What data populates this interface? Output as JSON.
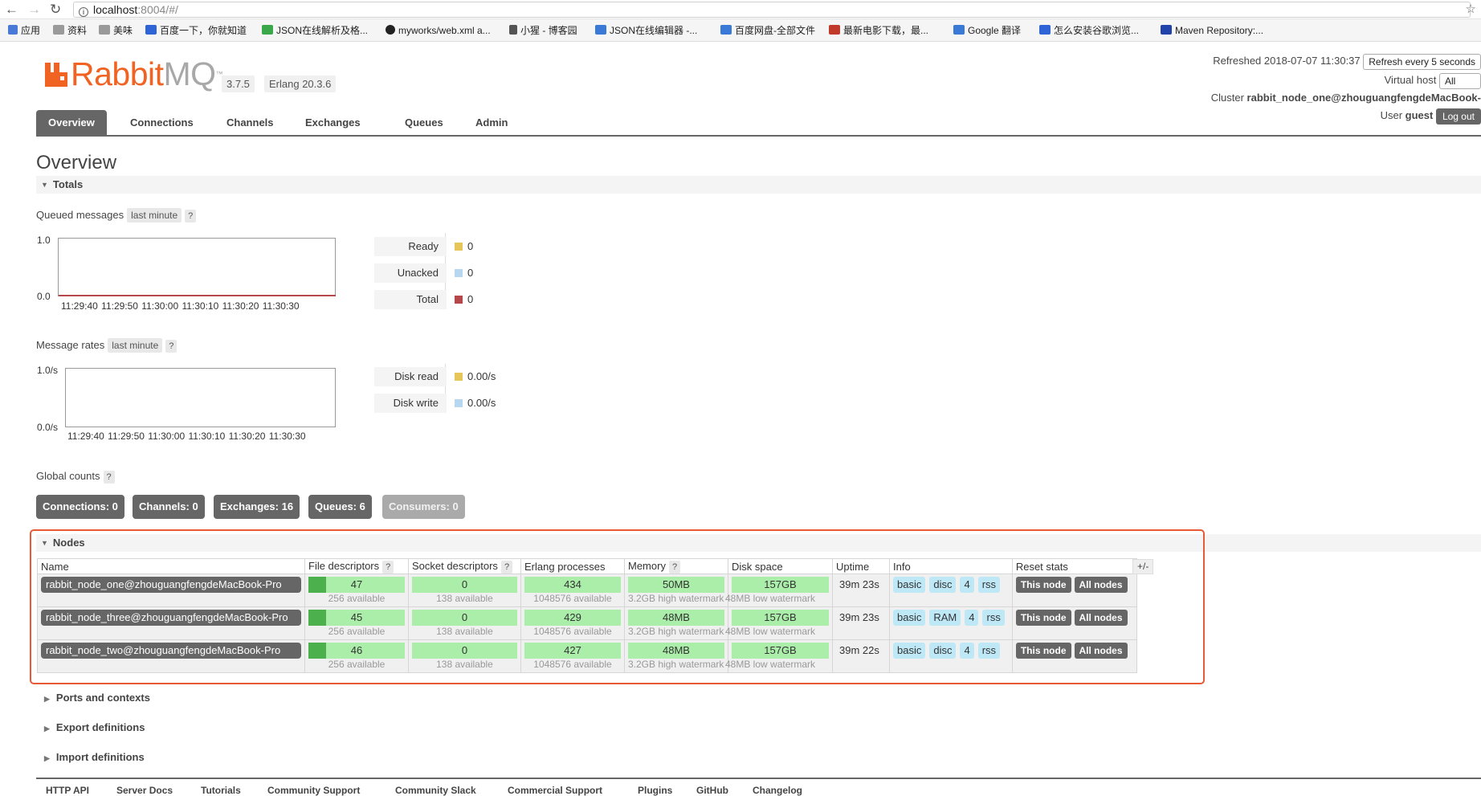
{
  "browser": {
    "url_host": "localhost",
    "url_path": ":8004/#/",
    "bookmarks": [
      {
        "label": "应用",
        "color": "#4a78d6"
      },
      {
        "label": "资料",
        "color": "#9a9a9a"
      },
      {
        "label": "美味",
        "color": "#9a9a9a"
      },
      {
        "label": "百度一下，你就知道",
        "color": "#2f64d6"
      },
      {
        "label": "JSON在线解析及格...",
        "color": "#3aa84a"
      },
      {
        "label": "myworks/web.xml a...",
        "color": "#222222"
      },
      {
        "label": "小猩 - 博客园",
        "color": "#555555"
      },
      {
        "label": "JSON在线编辑器 -...",
        "color": "#3a7ad6"
      },
      {
        "label": "百度网盘-全部文件",
        "color": "#3a7ad6"
      },
      {
        "label": "最新电影下载，最...",
        "color": "#c0392b"
      },
      {
        "label": "Google 翻译",
        "color": "#3a7ad6"
      },
      {
        "label": "怎么安装谷歌浏览...",
        "color": "#2f64d6"
      },
      {
        "label": "Maven Repository:...",
        "color": "#2244aa"
      }
    ]
  },
  "header": {
    "logo_r": "Rabbit",
    "logo_m": "MQ",
    "logo_tm": "™",
    "version": "3.7.5",
    "erlang": "Erlang 20.3.6",
    "refreshed": "Refreshed 2018-07-07 11:30:37",
    "refresh_select": "Refresh every 5 seconds",
    "vhost_label": "Virtual host",
    "vhost_value": "All",
    "cluster_label": "Cluster",
    "cluster_value": "rabbit_node_one@zhouguangfengdeMacBook-",
    "user_label": "User",
    "user_value": "guest",
    "logout": "Log out"
  },
  "tabs": [
    "Overview",
    "Connections",
    "Channels",
    "Exchanges",
    "Queues",
    "Admin"
  ],
  "page_title": "Overview",
  "totals": {
    "title": "Totals",
    "queued": {
      "label": "Queued messages",
      "range": "last minute",
      "help": "?",
      "y_max": "1.0",
      "y_min": "0.0",
      "x_ticks": "11:29:40 11:29:50 11:30:00 11:30:10 11:30:20 11:30:30",
      "legend": [
        {
          "name": "Ready",
          "value": "0",
          "color": "#e6c55a"
        },
        {
          "name": "Unacked",
          "value": "0",
          "color": "#b7d6ef"
        },
        {
          "name": "Total",
          "value": "0",
          "color": "#b5474a"
        }
      ]
    },
    "rates": {
      "label": "Message rates",
      "range": "last minute",
      "help": "?",
      "y_max": "1.0/s",
      "y_min": "0.0/s",
      "x_ticks": "11:29:40 11:29:50 11:30:00 11:30:10 11:30:20 11:30:30",
      "legend": [
        {
          "name": "Disk read",
          "value": "0.00/s",
          "color": "#e6c55a"
        },
        {
          "name": "Disk write",
          "value": "0.00/s",
          "color": "#b7d6ef"
        }
      ]
    },
    "global_counts_label": "Global counts",
    "counts": [
      {
        "label": "Connections: 0"
      },
      {
        "label": "Channels: 0"
      },
      {
        "label": "Exchanges: 16"
      },
      {
        "label": "Queues: 6"
      },
      {
        "label": "Consumers: 0"
      }
    ]
  },
  "nodes": {
    "title": "Nodes",
    "columns": [
      "Name",
      "File descriptors",
      "Socket descriptors",
      "Erlang processes",
      "Memory",
      "Disk space",
      "Uptime",
      "Info",
      "Reset stats"
    ],
    "help": "?",
    "toggle": "+/-",
    "rows": [
      {
        "name": "rabbit_node_one@zhouguangfengdeMacBook-Pro",
        "fd": "47",
        "fd_sub": "256 available",
        "fd_fill": 0.18,
        "sockets": "0",
        "sockets_sub": "138 available",
        "procs": "434",
        "procs_sub": "1048576 available",
        "memory": "50MB",
        "memory_sub": "3.2GB high watermark",
        "disk": "157GB",
        "disk_sub": "48MB low watermark",
        "uptime": "39m 23s",
        "info": [
          "basic",
          "disc",
          "4",
          "rss"
        ],
        "reset": [
          "This node",
          "All nodes"
        ]
      },
      {
        "name": "rabbit_node_three@zhouguangfengdeMacBook-Pro",
        "fd": "45",
        "fd_sub": "256 available",
        "fd_fill": 0.18,
        "sockets": "0",
        "sockets_sub": "138 available",
        "procs": "429",
        "procs_sub": "1048576 available",
        "memory": "48MB",
        "memory_sub": "3.2GB high watermark",
        "disk": "157GB",
        "disk_sub": "48MB low watermark",
        "uptime": "39m 23s",
        "info": [
          "basic",
          "RAM",
          "4",
          "rss"
        ],
        "reset": [
          "This node",
          "All nodes"
        ]
      },
      {
        "name": "rabbit_node_two@zhouguangfengdeMacBook-Pro",
        "fd": "46",
        "fd_sub": "256 available",
        "fd_fill": 0.18,
        "sockets": "0",
        "sockets_sub": "138 available",
        "procs": "427",
        "procs_sub": "1048576 available",
        "memory": "48MB",
        "memory_sub": "3.2GB high watermark",
        "disk": "157GB",
        "disk_sub": "48MB low watermark",
        "uptime": "39m 22s",
        "info": [
          "basic",
          "disc",
          "4",
          "rss"
        ],
        "reset": [
          "This node",
          "All nodes"
        ]
      }
    ]
  },
  "sections": [
    "Ports and contexts",
    "Export definitions",
    "Import definitions"
  ],
  "footer": [
    "HTTP API",
    "Server Docs",
    "Tutorials",
    "Community Support",
    "Community Slack",
    "Commercial Support",
    "Plugins",
    "GitHub",
    "Changelog"
  ],
  "colors": {
    "accent": "#f06322",
    "highlight_box": "#e85a35",
    "bar_bg": "#aaeeaa",
    "bar_fill": "#4cb14c",
    "tag_bg": "#bfe8f7"
  }
}
